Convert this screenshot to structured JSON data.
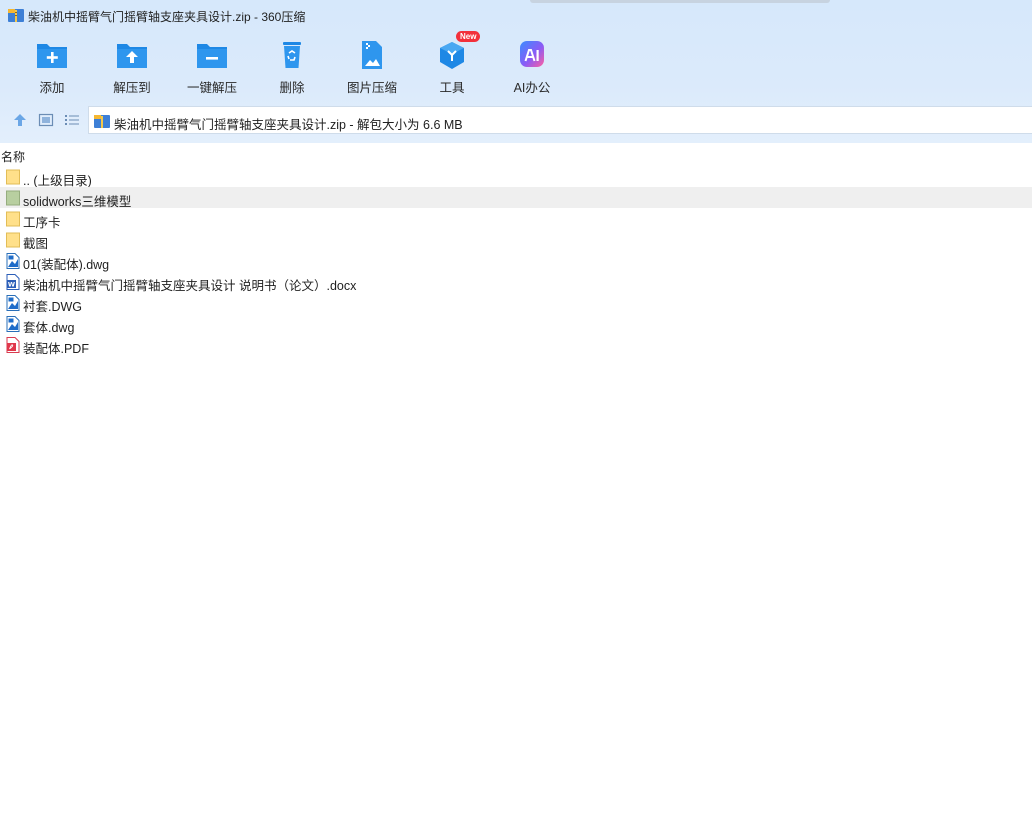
{
  "window": {
    "title": "柴油机中摇臂气门摇臂轴支座夹具设计.zip - 360压缩"
  },
  "toolbar": {
    "buttons": [
      {
        "label": "添加",
        "icon": "add-folder-icon"
      },
      {
        "label": "解压到",
        "icon": "extract-to-folder-icon"
      },
      {
        "label": "一键解压",
        "icon": "one-click-extract-icon"
      },
      {
        "label": "删除",
        "icon": "recycle-bin-icon"
      },
      {
        "label": "图片压缩",
        "icon": "image-compress-icon"
      },
      {
        "label": "工具",
        "icon": "tools-cube-icon",
        "badge": "New"
      },
      {
        "label": "AI办公",
        "icon": "ai-office-icon"
      }
    ]
  },
  "nav": {
    "address": "柴油机中摇臂气门摇臂轴支座夹具设计.zip - 解包大小为 6.6 MB"
  },
  "columns": {
    "name": "名称"
  },
  "files": [
    {
      "name": ".. (上级目录)",
      "icon": "folder-icon",
      "selected": false
    },
    {
      "name": "solidworks三维模型",
      "icon": "folder-icon",
      "selected": true
    },
    {
      "name": "工序卡",
      "icon": "folder-icon",
      "selected": false
    },
    {
      "name": "截图",
      "icon": "folder-icon",
      "selected": false
    },
    {
      "name": "01(装配体).dwg",
      "icon": "dwg-file-icon",
      "selected": false
    },
    {
      "name": "柴油机中摇臂气门摇臂轴支座夹具设计 说明书（论文）.docx",
      "icon": "word-file-icon",
      "selected": false
    },
    {
      "name": "衬套.DWG",
      "icon": "dwg-file-icon",
      "selected": false
    },
    {
      "name": "套体.dwg",
      "icon": "dwg-file-icon",
      "selected": false
    },
    {
      "name": "装配体.PDF",
      "icon": "pdf-file-icon",
      "selected": false
    }
  ],
  "colors": {
    "accent": "#1e88e5",
    "toolbar_bg": "#d9e9fb",
    "selected_row": "#efefef",
    "folder": "#ffe08a",
    "badge": "#f2303b"
  }
}
